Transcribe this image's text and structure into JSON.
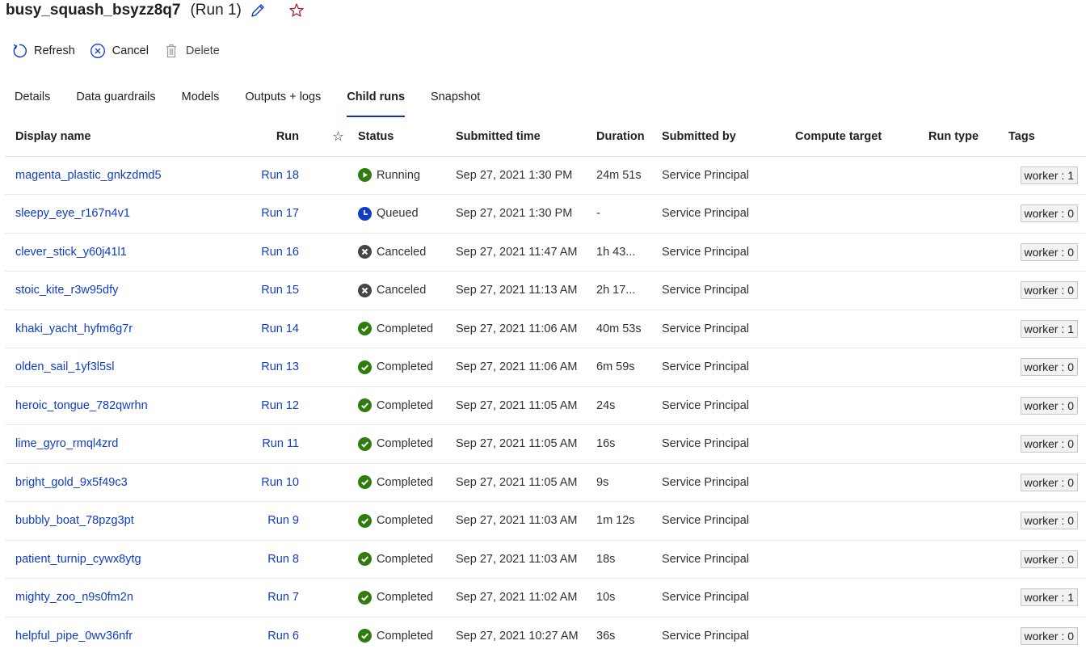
{
  "header": {
    "name": "busy_squash_bsyzz8q7",
    "run": "(Run 1)",
    "edit_icon": "pencil-icon",
    "favorite_icon": "star-outline-icon"
  },
  "toolbar": {
    "refresh_label": "Refresh",
    "cancel_label": "Cancel",
    "delete_label": "Delete"
  },
  "tabs": [
    {
      "label": "Details",
      "active": false
    },
    {
      "label": "Data guardrails",
      "active": false
    },
    {
      "label": "Models",
      "active": false
    },
    {
      "label": "Outputs + logs",
      "active": false
    },
    {
      "label": "Child runs",
      "active": true
    },
    {
      "label": "Snapshot",
      "active": false
    }
  ],
  "table": {
    "columns": {
      "display_name": "Display name",
      "run": "Run",
      "favorite": "☆",
      "status": "Status",
      "submitted_time": "Submitted time",
      "duration": "Duration",
      "submitted_by": "Submitted by",
      "compute_target": "Compute target",
      "run_type": "Run type",
      "tags": "Tags"
    },
    "status_colors": {
      "Running": "#2f7d0f",
      "Queued": "#0f3dc4",
      "Canceled": "#484644",
      "Completed": "#2f7d0f"
    },
    "rows": [
      {
        "name": "magenta_plastic_gnkzdmd5",
        "run": "Run 18",
        "status": "Running",
        "submitted": "Sep 27, 2021 1:30 PM",
        "duration": "24m 51s",
        "by": "Service Principal",
        "compute": "",
        "type": "",
        "tag": "worker : 1"
      },
      {
        "name": "sleepy_eye_r167n4v1",
        "run": "Run 17",
        "status": "Queued",
        "submitted": "Sep 27, 2021 1:30 PM",
        "duration": "-",
        "by": "Service Principal",
        "compute": "",
        "type": "",
        "tag": "worker : 0"
      },
      {
        "name": "clever_stick_y60j41l1",
        "run": "Run 16",
        "status": "Canceled",
        "submitted": "Sep 27, 2021 11:47 AM",
        "duration": "1h 43...",
        "by": "Service Principal",
        "compute": "",
        "type": "",
        "tag": "worker : 0"
      },
      {
        "name": "stoic_kite_r3w95dfy",
        "run": "Run 15",
        "status": "Canceled",
        "submitted": "Sep 27, 2021 11:13 AM",
        "duration": "2h 17...",
        "by": "Service Principal",
        "compute": "",
        "type": "",
        "tag": "worker : 0"
      },
      {
        "name": "khaki_yacht_hyfm6g7r",
        "run": "Run 14",
        "status": "Completed",
        "submitted": "Sep 27, 2021 11:06 AM",
        "duration": "40m 53s",
        "by": "Service Principal",
        "compute": "",
        "type": "",
        "tag": "worker : 1"
      },
      {
        "name": "olden_sail_1yf3l5sl",
        "run": "Run 13",
        "status": "Completed",
        "submitted": "Sep 27, 2021 11:06 AM",
        "duration": "6m 59s",
        "by": "Service Principal",
        "compute": "",
        "type": "",
        "tag": "worker : 0"
      },
      {
        "name": "heroic_tongue_782qwrhn",
        "run": "Run 12",
        "status": "Completed",
        "submitted": "Sep 27, 2021 11:05 AM",
        "duration": "24s",
        "by": "Service Principal",
        "compute": "",
        "type": "",
        "tag": "worker : 0"
      },
      {
        "name": "lime_gyro_rmql4zrd",
        "run": "Run 11",
        "status": "Completed",
        "submitted": "Sep 27, 2021 11:05 AM",
        "duration": "16s",
        "by": "Service Principal",
        "compute": "",
        "type": "",
        "tag": "worker : 0"
      },
      {
        "name": "bright_gold_9x5f49c3",
        "run": "Run 10",
        "status": "Completed",
        "submitted": "Sep 27, 2021 11:05 AM",
        "duration": "9s",
        "by": "Service Principal",
        "compute": "",
        "type": "",
        "tag": "worker : 0"
      },
      {
        "name": "bubbly_boat_78pzg3pt",
        "run": "Run 9",
        "status": "Completed",
        "submitted": "Sep 27, 2021 11:03 AM",
        "duration": "1m 12s",
        "by": "Service Principal",
        "compute": "",
        "type": "",
        "tag": "worker : 0"
      },
      {
        "name": "patient_turnip_cywx8ytg",
        "run": "Run 8",
        "status": "Completed",
        "submitted": "Sep 27, 2021 11:03 AM",
        "duration": "18s",
        "by": "Service Principal",
        "compute": "",
        "type": "",
        "tag": "worker : 0"
      },
      {
        "name": "mighty_zoo_n9s0fm2n",
        "run": "Run 7",
        "status": "Completed",
        "submitted": "Sep 27, 2021 11:02 AM",
        "duration": "10s",
        "by": "Service Principal",
        "compute": "",
        "type": "",
        "tag": "worker : 1"
      },
      {
        "name": "helpful_pipe_0wv36nfr",
        "run": "Run 6",
        "status": "Completed",
        "submitted": "Sep 27, 2021 10:27 AM",
        "duration": "36s",
        "by": "Service Principal",
        "compute": "",
        "type": "",
        "tag": "worker : 0"
      }
    ]
  }
}
